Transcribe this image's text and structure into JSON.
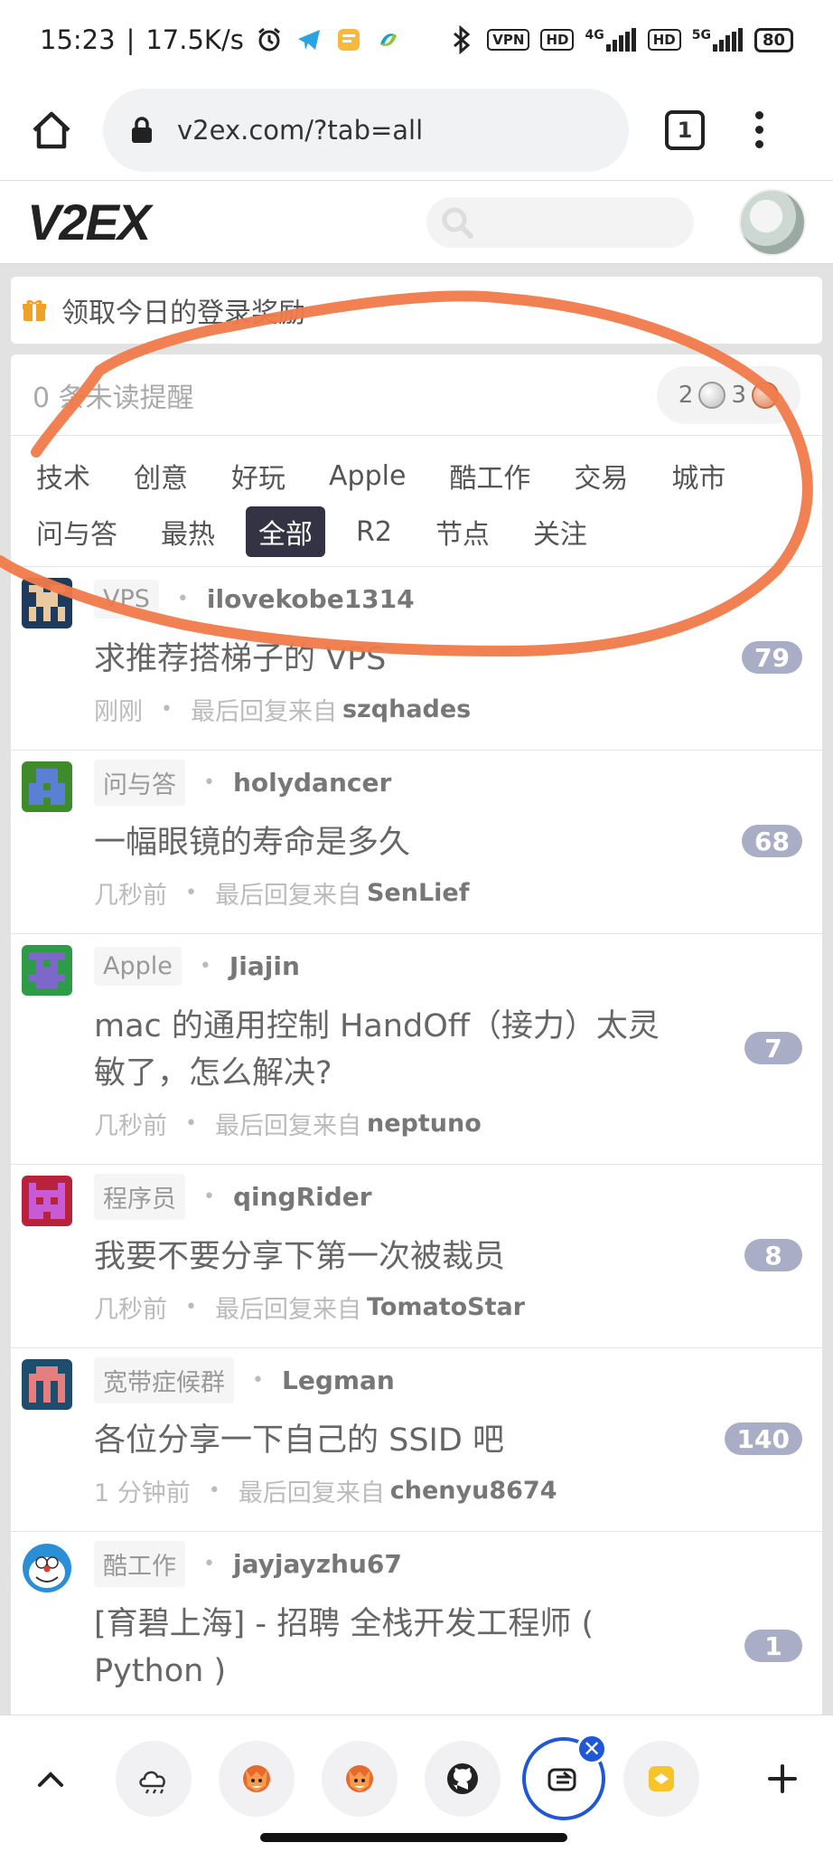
{
  "status_bar": {
    "time": "15:23",
    "speed": "17.5K/s",
    "vpn": "VPN",
    "hd1": "HD",
    "net1": "4G",
    "hd2": "HD",
    "net2": "5G",
    "battery": "80"
  },
  "browser": {
    "url": "v2ex.com/?tab=all",
    "tab_count": "1"
  },
  "header": {
    "logo": "V2EX",
    "search_placeholder": ""
  },
  "reward": {
    "text": "领取今日的登录奖励"
  },
  "notifications": {
    "text": "0 条未读提醒",
    "silver": "2",
    "bronze": "3"
  },
  "tabs_row1": [
    "技术",
    "创意",
    "好玩",
    "Apple",
    "酷工作",
    "交易",
    "城市"
  ],
  "tabs_row2": [
    "问与答",
    "最热",
    "全部",
    "R2",
    "节点",
    "关注"
  ],
  "active_tab": "全部",
  "topics": [
    {
      "node": "VPS",
      "author": "ilovekobe1314",
      "title": "求推荐搭梯子的 VPS",
      "replies": "79",
      "time": "刚刚",
      "last_label": "最后回复来自",
      "last_reply": "szqhades"
    },
    {
      "node": "问与答",
      "author": "holydancer",
      "title": "一幅眼镜的寿命是多久",
      "replies": "68",
      "time": "几秒前",
      "last_label": "最后回复来自",
      "last_reply": "SenLief"
    },
    {
      "node": "Apple",
      "author": "Jiajin",
      "title": "mac 的通用控制 HandOff（接力）太灵敏了，怎么解决?",
      "replies": "7",
      "time": "几秒前",
      "last_label": "最后回复来自",
      "last_reply": "neptuno"
    },
    {
      "node": "程序员",
      "author": "qingRider",
      "title": "我要不要分享下第一次被裁员",
      "replies": "8",
      "time": "几秒前",
      "last_label": "最后回复来自",
      "last_reply": "TomatoStar"
    },
    {
      "node": "宽带症候群",
      "author": "Legman",
      "title": "各位分享一下自己的 SSID 吧",
      "replies": "140",
      "time": "1 分钟前",
      "last_label": "最后回复来自",
      "last_reply": "chenyu8674"
    },
    {
      "node": "酷工作",
      "author": "jayjayzhu67",
      "title": "[育碧上海] - 招聘 全栈开发工程师 ( Python )",
      "replies": "1",
      "time": "",
      "last_label": "",
      "last_reply": ""
    }
  ],
  "colors": {
    "annotation": "#f07a4a",
    "active_tab_bg": "#334455",
    "reply_badge": "#a9aec6",
    "accent_blue": "#1f57d6"
  }
}
